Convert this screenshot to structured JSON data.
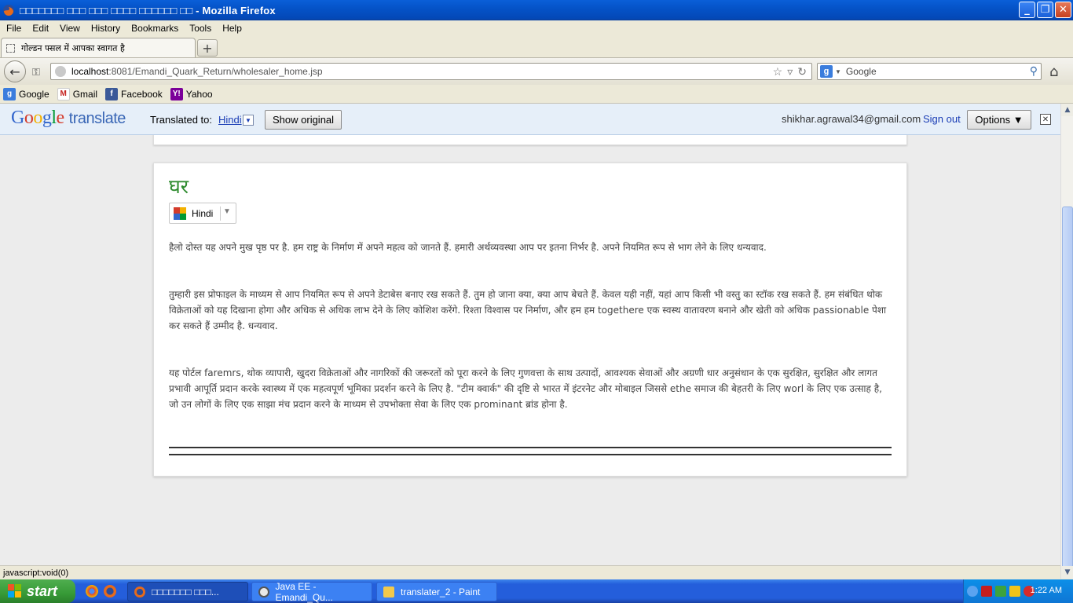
{
  "window": {
    "title": "□□□□□□□ □□□ □□□ □□□□ □□□□□□ □□ - Mozilla Firefox"
  },
  "menu": [
    "File",
    "Edit",
    "View",
    "History",
    "Bookmarks",
    "Tools",
    "Help"
  ],
  "tab": {
    "title": "गोल्डन फ्सल में आपका स्वागत है",
    "new_tab": "+"
  },
  "nav": {
    "url_host": "localhost",
    "url_path": ":8081/Emandi_Quark_Return/wholesaler_home.jsp",
    "search_placeholder": "Google"
  },
  "bookmarks": [
    "Google",
    "Gmail",
    "Facebook",
    "Yahoo"
  ],
  "translate_bar": {
    "logo_google": "Google",
    "logo_translate": "translate",
    "translated_to": "Translated to:",
    "language": "Hindi",
    "show_original": "Show original",
    "email": "shikhar.agrawal34@gmail.com",
    "sign_out": "Sign out",
    "options": "Options ▼",
    "close": "✕"
  },
  "content": {
    "heading": "घर",
    "language_selector": "Hindi",
    "paragraphs": [
      "हैलो दोस्त यह अपने मुख पृष्ठ पर है. हम राष्ट्र के निर्माण में अपने महत्व को जानते हैं. हमारी अर्थव्यवस्था आप पर इतना निर्भर है. अपने नियमित रूप से भाग लेने के लिए धन्यवाद.",
      "तुम्हारी इस प्रोफाइल के माध्यम से आप नियमित रूप से अपने डेटाबेस बनाए रख सकते हैं. तुम हो जाना क्या, क्या आप बेचते हैं. केवल यही नहीं, यहां आप किसी भी वस्तु का स्टॉक रख सकते हैं. हम संबंधित थोक विक्रेताओं को यह दिखाना होगा और अधिक से अधिक लाभ देने के लिए कोशिश करेंगे. रिश्ता विश्वास पर निर्माण, और हम हम togethere एक स्वस्थ वातावरण बनाने और खेती को अधिक passionable पेशा कर सकते हैं उम्मीद है. धन्यवाद.",
      "यह पोर्टल faremrs, थोक व्यापारी, खुदरा विक्रेताओं और नागरिकों की जरूरतों को पूरा करने के लिए गुणवत्ता के साथ उत्पादों, आवश्यक सेवाओं और अग्रणी धार अनुसंधान के एक सुरक्षित, सुरक्षित और लागत प्रभावी आपूर्ति प्रदान करके स्वास्थ्य में एक महत्वपूर्ण भूमिका प्रदर्शन करने के लिए है. \"टीम क्वार्क\" की दृष्टि से भारत में इंटरनेट और मोबाइल जिससे ethe समाज की बेहतरी के लिए worl के लिए एक उत्साह है, जो उन लोगों के लिए एक साझा मंच प्रदान करने के माध्यम से उपभोक्ता सेवा के लिए एक prominant ब्रांड होना है."
    ]
  },
  "status": {
    "text": "javascript:void(0)"
  },
  "taskbar": {
    "start": "start",
    "items": [
      "□□□□□□□ □□□...",
      "Java EE - Emandi_Qu...",
      "translater_2 - Paint"
    ],
    "clock": "1:22 AM"
  },
  "colors": {
    "heading_green": "#2e8b2e",
    "link_blue": "#1a3db5",
    "translate_bar_bg": "#e6eff9"
  }
}
